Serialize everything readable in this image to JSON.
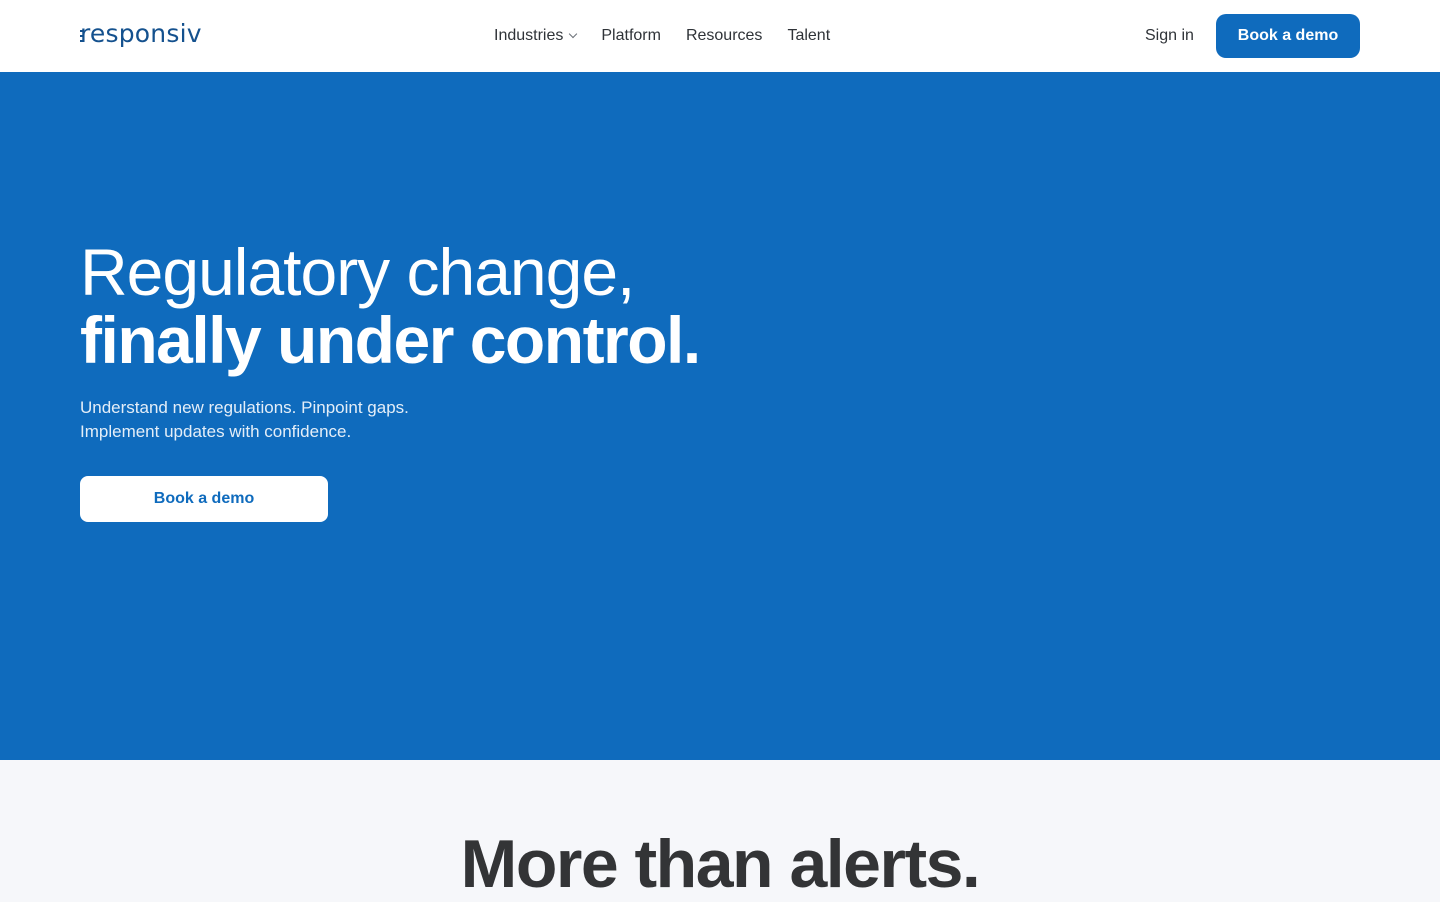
{
  "header": {
    "logo_text": "responsiv",
    "nav": [
      {
        "label": "Industries",
        "has_dropdown": true
      },
      {
        "label": "Platform",
        "has_dropdown": false
      },
      {
        "label": "Resources",
        "has_dropdown": false
      },
      {
        "label": "Talent",
        "has_dropdown": false
      }
    ],
    "signin_label": "Sign in",
    "cta_label": "Book a demo"
  },
  "hero": {
    "title_line1": "Regulatory change,",
    "title_line2": "finally under control.",
    "subtitle_line1": "Understand new regulations. Pinpoint gaps.",
    "subtitle_line2": "Implement updates with confidence.",
    "cta_label": "Book a demo"
  },
  "section_more": {
    "title": "More than alerts."
  },
  "colors": {
    "brand_blue": "#0f6bbd",
    "logo_blue": "#14518e",
    "header_bg": "#ffffff",
    "section_bg": "#f6f7fa",
    "heading_dark": "#333436"
  }
}
